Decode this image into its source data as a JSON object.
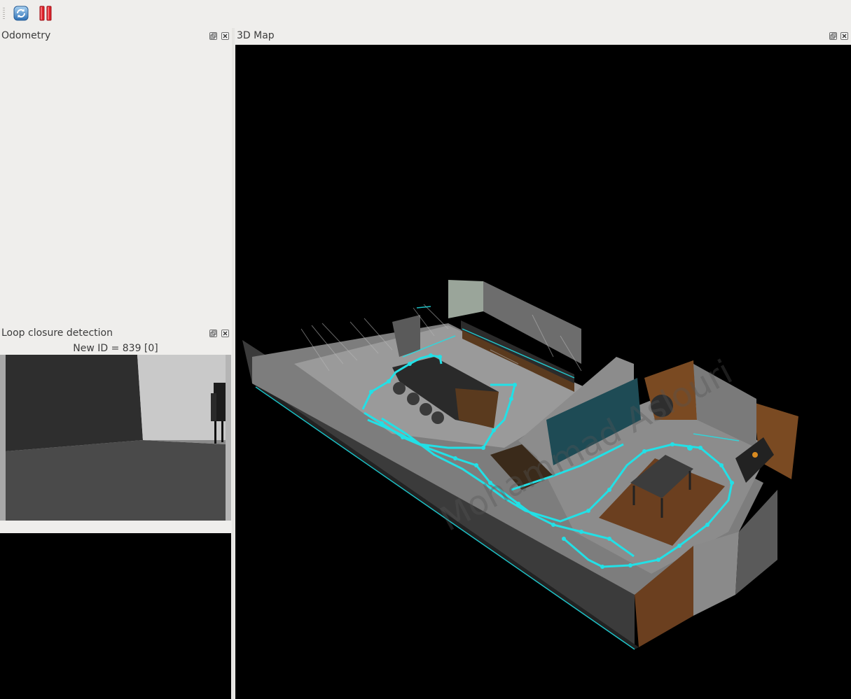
{
  "toolbar": {
    "refresh_icon": "refresh-icon",
    "pause_icon": "pause-icon"
  },
  "odometry": {
    "title": "Odometry"
  },
  "loop_closure": {
    "title": "Loop closure detection",
    "status": "New ID = 839 [0]"
  },
  "map3d": {
    "title": "3D Map",
    "watermark": "Mohammad Aslouri"
  },
  "colors": {
    "window_bg": "#efeeec",
    "map_bg": "#000000",
    "trajectory": "#22e0e6",
    "wall_gray": "#3a3a3a",
    "floor_gray": "#8a8a8a",
    "wood": "#6b3f1f"
  }
}
